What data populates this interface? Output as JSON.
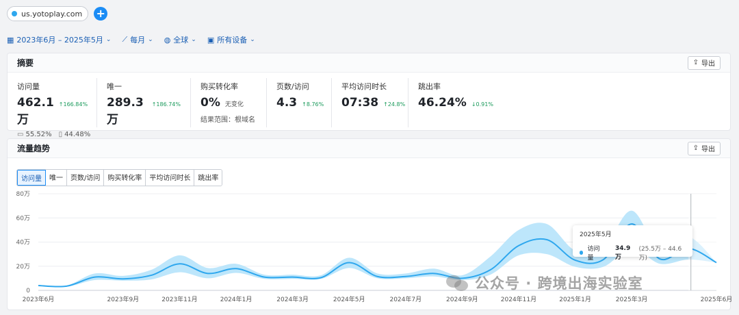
{
  "top": {
    "domain": "us.yotoplay.com",
    "add_label": "+"
  },
  "filters": {
    "date_range": "2023年6月 – 2025年5月",
    "granularity": "每月",
    "region": "全球",
    "device": "所有设备"
  },
  "summary": {
    "title": "摘要",
    "export_label": "导出",
    "metrics": [
      {
        "label": "访问量",
        "value": "462.1万",
        "change": "↑166.84%",
        "desktop_pct": "55.52%",
        "mobile_pct": "44.48%"
      },
      {
        "label": "唯一",
        "value": "289.3万",
        "change": "↑186.74%"
      },
      {
        "label": "购买转化率",
        "value": "0%",
        "note": "无变化",
        "sub": "结果范围：根域名"
      },
      {
        "label": "页数/访问",
        "value": "4.3",
        "change": "↑8.76%"
      },
      {
        "label": "平均访问时长",
        "value": "07:38",
        "change": "↑24.8%"
      },
      {
        "label": "跳出率",
        "value": "46.24%",
        "change": "↓0.91%"
      }
    ]
  },
  "trend": {
    "title": "流量趋势",
    "export_label": "导出",
    "tabs": [
      "访问量",
      "唯一",
      "页数/访问",
      "购买转化率",
      "平均访问时长",
      "跳出率"
    ],
    "active_tab": 0,
    "tooltip": {
      "title": "2025年5月",
      "series": "访问量",
      "value": "34.9万",
      "range": "(25.5万 – 44.6万)"
    }
  },
  "chart_data": {
    "type": "line",
    "y_ticks": [
      "80万",
      "60万",
      "40万",
      "20万",
      "0"
    ],
    "ylim": [
      0,
      80
    ],
    "unit": "万",
    "x_tick_labels": [
      "2023年6月",
      "2023年9月",
      "2023年11月",
      "2024年1月",
      "2024年3月",
      "2024年5月",
      "2024年7月",
      "2024年9月",
      "2024年11月",
      "2025年1月",
      "2025年3月",
      "2025年6月"
    ],
    "x": [
      "2023-06",
      "2023-07",
      "2023-08",
      "2023-09",
      "2023-10",
      "2023-11",
      "2023-12",
      "2024-01",
      "2024-02",
      "2024-03",
      "2024-04",
      "2024-05",
      "2024-06",
      "2024-07",
      "2024-08",
      "2024-09",
      "2024-10",
      "2024-11",
      "2024-12",
      "2025-01",
      "2025-02",
      "2025-03",
      "2025-04",
      "2025-05",
      "2025-06"
    ],
    "series": [
      {
        "name": "访问量",
        "values": [
          4,
          3.5,
          11,
          9.5,
          12.5,
          22,
          14,
          18,
          11,
          11,
          10.5,
          23,
          11.5,
          11.5,
          14,
          10,
          17,
          37,
          42,
          25,
          25.5,
          55,
          26,
          34.9,
          23
        ]
      }
    ],
    "band_upper": [
      4,
      4,
      14,
      12,
      17,
      29,
      18.5,
      22,
      13,
      13,
      12.5,
      27,
      14,
      14,
      18,
      12.5,
      28,
      50,
      55,
      33,
      35,
      66,
      32,
      44.6,
      23
    ],
    "band_lower": [
      4,
      3,
      8.5,
      8,
      9,
      15,
      10,
      14.5,
      9.5,
      9.5,
      9.5,
      18.5,
      10,
      10,
      11.5,
      8.5,
      13,
      29,
      30,
      19.5,
      19.5,
      35,
      22,
      25.5,
      23
    ],
    "colors": {
      "line": "#2ea7ee",
      "band": "#b6e3fb",
      "band_forecast": "#dbf1fd"
    },
    "highlighted_index": 23
  },
  "watermark": {
    "text": "公众号 · 跨境出海实验室"
  }
}
